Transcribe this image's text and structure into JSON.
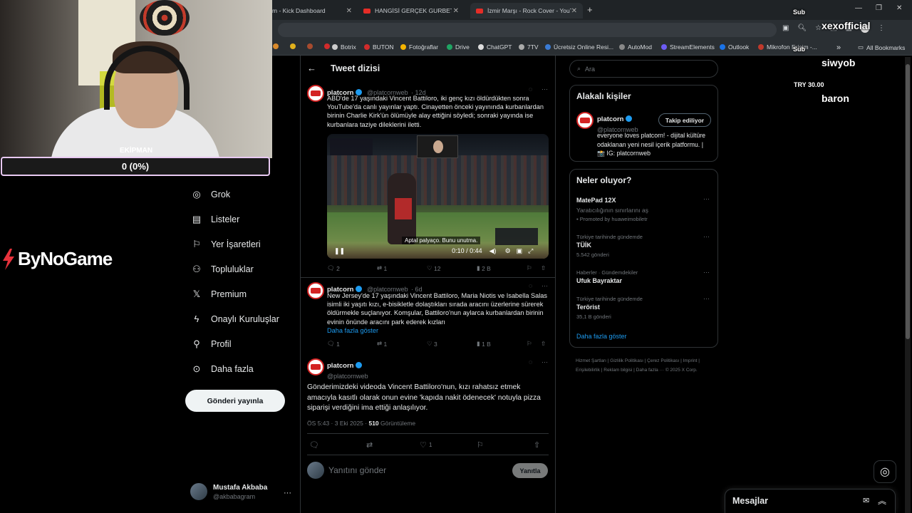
{
  "browser": {
    "tabs": [
      {
        "title": "m - Kick Dashboard"
      },
      {
        "title": "HANGİSİ GERÇEK GURBETÇİ?! F"
      },
      {
        "title": "İzmir Marşı - Rock Cover - YouT"
      }
    ],
    "new_tab": "+",
    "bookmarks": [
      "Botrix",
      "BUTON",
      "Fotoğraflar",
      "Drive",
      "ChatGPT",
      "7TV",
      "Ücretsiz Online Resi...",
      "AutoMod",
      "StreamElements",
      "Outlook",
      "Mikrofon Erişim -..."
    ],
    "bookmarks_overflow": "»",
    "all_bookmarks": "All Bookmarks"
  },
  "stream": {
    "goal_label": "EKİPMAN",
    "goal_text": "0 (0%)",
    "goal_progress": 0,
    "sponsor_logo": "ByNoGame",
    "alerts": [
      {
        "label": "Sub",
        "name": "xexofficial"
      },
      {
        "label": "Sub",
        "name": "siwyob"
      },
      {
        "label": "TRY 30.00",
        "name": "baron"
      }
    ]
  },
  "nav": {
    "items": [
      {
        "label": "Grok",
        "icon": "grok-icon"
      },
      {
        "label": "Listeler",
        "icon": "list-icon"
      },
      {
        "label": "Yer İşaretleri",
        "icon": "bookmark-icon"
      },
      {
        "label": "Topluluklar",
        "icon": "communities-icon"
      },
      {
        "label": "Premium",
        "icon": "x-logo-icon"
      },
      {
        "label": "Onaylı Kuruluşlar",
        "icon": "lightning-icon"
      },
      {
        "label": "Profil",
        "icon": "person-icon"
      },
      {
        "label": "Daha fazla",
        "icon": "more-circle-icon"
      }
    ],
    "post_button": "Gönderi yayınla",
    "account": {
      "name": "Mustafa Akbaba",
      "handle": "@akbabagram",
      "more": "···"
    }
  },
  "thread": {
    "title": "Tweet dizisi",
    "tweets": [
      {
        "name": "platcorn",
        "handle": "@platcornweb",
        "time": "· 12d",
        "text": "ABD'de 17 yaşındaki Vincent Battiloro, iki genç kızı öldürdükten sonra YouTube'da canlı yayınlar yaptı. Cinayetten önceki yayınında kurbanlardan birinin Charlie Kirk'ün ölümüyle alay ettiğini söyledi; sonraki yayında ise kurbanlara taziye dileklerini iletti.",
        "video": {
          "subtitle": "Aptal palyaço. Bunu unutma.",
          "time": "0:10 / 0:44"
        },
        "replies": "2",
        "reposts": "1",
        "likes": "12",
        "views": "2 B"
      },
      {
        "name": "platcorn",
        "handle": "@platcornweb",
        "time": "· 6d",
        "text": "New Jersey'de 17 yaşındaki Vincent Battiloro, Maria Niotis ve Isabella Salas isimli iki yaşıtı kızı, e-bisikletle dolaştıkları sırada aracını üzerlerine sürerek öldürmekle suçlanıyor. Komşular, Battiloro'nun aylarca kurbanlardan birinin evinin önünde aracını park ederek kızları",
        "show_more": "Daha fazla göster",
        "replies": "1",
        "reposts": "1",
        "likes": "3",
        "views": "1 B"
      }
    ],
    "main_tweet": {
      "name": "platcorn",
      "handle": "@platcornweb",
      "text": "Gönderimizdeki videoda Vincent Battiloro'nun, kızı rahatsız etmek amacıyla kasıtlı olarak onun evine 'kapıda nakit ödenecek' notuyla pizza siparişi verdiğini ima ettiği anlaşılıyor.",
      "timestamp": "ÖS 5:43 · 3 Eki 2025 · ",
      "views": "510",
      "views_label": " Görüntüleme",
      "likes": "1"
    },
    "reply_placeholder": "Yanıtını gönder",
    "reply_button": "Yanıtla"
  },
  "sidebar": {
    "search_placeholder": "Ara",
    "related": {
      "title": "Alakalı kişiler",
      "name": "platcorn",
      "handle": "@platcornweb",
      "follow_label": "Takip ediliyor",
      "bio": "everyone loves platcorn! - dijital kültüre odaklanan yeni nesil içerik platformu. | 📸 IG: platcornweb"
    },
    "trends": {
      "title": "Neler oluyor?",
      "items": [
        {
          "context": "",
          "name": "MatePad 12X",
          "sub": "Yaratıcılığının sınırlarını aş",
          "promo": "Promoted by huaweimobiletr"
        },
        {
          "context": "Türkiye tarihinde gündemde",
          "name": "TÜİK",
          "sub": "5.542 gönderi"
        },
        {
          "context": "Haberler · Gündemdekiler",
          "name": "Ufuk Bayraktar",
          "sub": ""
        },
        {
          "context": "Türkiye tarihinde gündemde",
          "name": "Terörist",
          "sub": "35,1 B gönderi"
        }
      ],
      "show_more": "Daha fazla göster"
    },
    "footer": "Hizmet Şartları  |  Gizlilik Politikası  |  Çerez Politikası  |  Imprint  |  Erişilebilirlik  |  Reklam bilgisi  |  Daha fazla ···  © 2025 X Corp."
  },
  "messages": {
    "title": "Mesajlar"
  }
}
